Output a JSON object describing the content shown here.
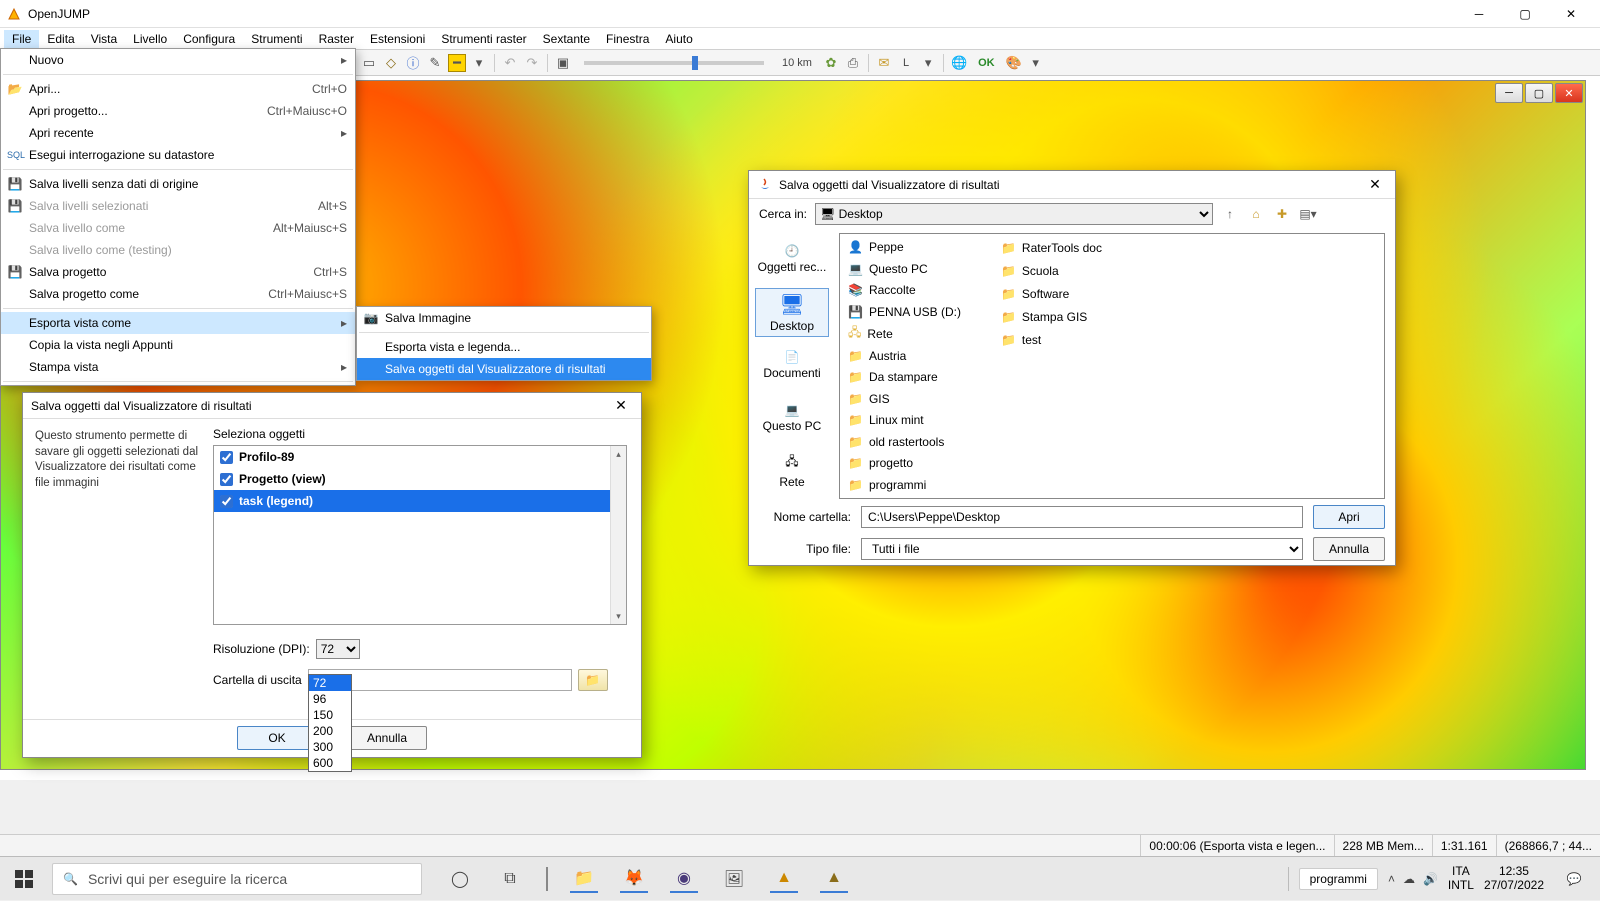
{
  "app": {
    "title": "OpenJUMP"
  },
  "menubar": [
    "File",
    "Edita",
    "Vista",
    "Livello",
    "Configura",
    "Strumenti",
    "Raster",
    "Estensioni",
    "Strumenti raster",
    "Sextante",
    "Finestra",
    "Aiuto"
  ],
  "toolbar": {
    "scale_text": "10 km",
    "layer_text": "L",
    "ok_text": "OK"
  },
  "file_menu": {
    "nuovo": "Nuovo",
    "sep1": true,
    "apri": {
      "label": "Apri...",
      "sc": "Ctrl+O"
    },
    "apri_progetto": {
      "label": "Apri progetto...",
      "sc": "Ctrl+Maiusc+O"
    },
    "apri_recente": "Apri recente",
    "esegui_query": "Esegui interrogazione su datastore",
    "sep2": true,
    "salva_livelli_senza": "Salva livelli senza dati di origine",
    "salva_livelli_sel": {
      "label": "Salva livelli selezionati",
      "sc": "Alt+S"
    },
    "salva_livello_come": {
      "label": "Salva livello come",
      "sc": "Alt+Maiusc+S"
    },
    "salva_livello_come_testing": "Salva livello come (testing)",
    "salva_progetto": {
      "label": "Salva progetto",
      "sc": "Ctrl+S"
    },
    "salva_progetto_come": {
      "label": "Salva progetto come",
      "sc": "Ctrl+Maiusc+S"
    },
    "sep3": true,
    "esporta_vista": "Esporta vista come",
    "copia_vista": "Copia la vista negli Appunti",
    "stampa_vista": "Stampa vista",
    "sep4": true
  },
  "submenu": {
    "salva_immagine": "Salva Immagine",
    "esporta_legenda": "Esporta vista e legenda...",
    "salva_oggetti": "Salva oggetti dal Visualizzatore di risultati"
  },
  "dialog1": {
    "title": "Salva oggetti dal Visualizzatore di risultati",
    "desc": "Questo strumento permette di savare gli oggetti selezionati dal Visualizzatore dei risultati come file immagini",
    "group": "Seleziona oggetti",
    "items": [
      "Profilo-89",
      "Progetto (view)",
      "task (legend)"
    ],
    "res_label": "Risoluzione (DPI):",
    "res_value": "72",
    "out_label": "Cartella di uscita",
    "out_value": "",
    "ok": "OK",
    "cancel": "Annulla"
  },
  "dpi_options": [
    "72",
    "96",
    "150",
    "200",
    "300",
    "600"
  ],
  "dialog2": {
    "title": "Salva oggetti dal Visualizzatore di risultati",
    "search_label": "Cerca in:",
    "search_value": "Desktop",
    "places": [
      "Oggetti rec...",
      "Desktop",
      "Documenti",
      "Questo PC",
      "Rete"
    ],
    "col1": [
      "Peppe",
      "Questo PC",
      "Raccolte",
      "PENNA USB (D:)",
      "Rete",
      "Austria",
      "Da stampare",
      "GIS",
      "Linux mint",
      "old rastertools",
      "progetto",
      "programmi"
    ],
    "col2": [
      "RaterTools doc",
      "Scuola",
      "Software",
      "Stampa GIS",
      "test"
    ],
    "name_label": "Nome cartella:",
    "name_value": "C:\\Users\\Peppe\\Desktop",
    "type_label": "Tipo file:",
    "type_value": "Tutti i file",
    "open": "Apri",
    "cancel": "Annulla"
  },
  "statusbar": {
    "time": "00:00:06 (Esporta vista e legen...",
    "mem": "228 MB Mem...",
    "scale": "1:31.161",
    "coords": "(268866,7 ; 44..."
  },
  "taskbar": {
    "search_placeholder": "Scrivi qui per eseguire la ricerca",
    "pill": "programmi",
    "lang1": "ITA",
    "lang2": "INTL",
    "time": "12:35",
    "date": "27/07/2022"
  }
}
